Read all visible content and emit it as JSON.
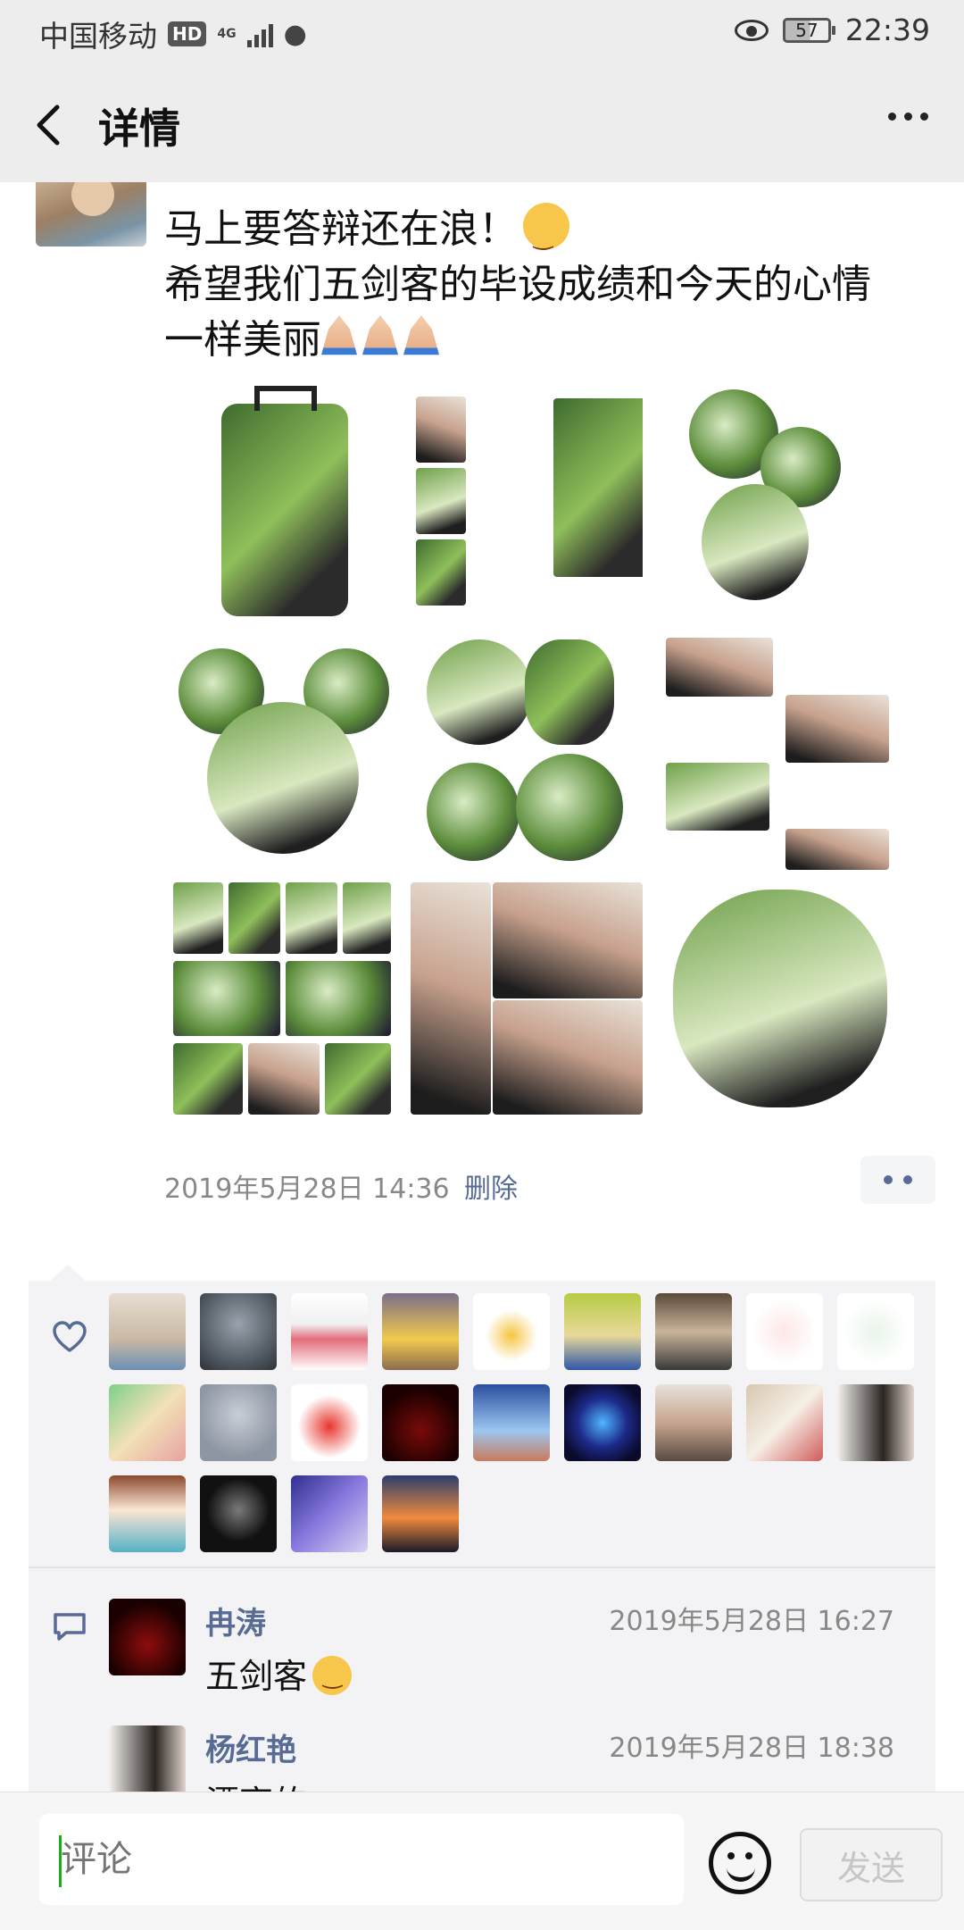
{
  "status_bar": {
    "carrier": "中国移动",
    "hd": "HD",
    "network": "4G",
    "battery": "57",
    "time": "22:39"
  },
  "nav": {
    "title": "详情"
  },
  "post": {
    "text_lines": [
      "马上要答辩还在浪！",
      "希望我们五剑客的毕设成绩和今天的心情",
      "一样美丽"
    ],
    "emoji": [
      "unamused-face",
      "folded-hands",
      "folded-hands",
      "folded-hands"
    ],
    "photo_count": 9,
    "timestamp": "2019年5月28日 14:36",
    "delete_label": "删除"
  },
  "likes": {
    "count": 22
  },
  "comments": [
    {
      "name": "冉涛",
      "time": "2019年5月28日 16:27",
      "text": "五剑客",
      "emoji": "flushed-face"
    },
    {
      "name": "杨红艳",
      "time": "2019年5月28日 18:38",
      "text": "漂亮的"
    }
  ],
  "input": {
    "placeholder": "评论",
    "send_label": "发送"
  },
  "colors": {
    "link": "#576b95",
    "bar_bg": "#ededed",
    "panel_bg": "#f3f3f5"
  }
}
